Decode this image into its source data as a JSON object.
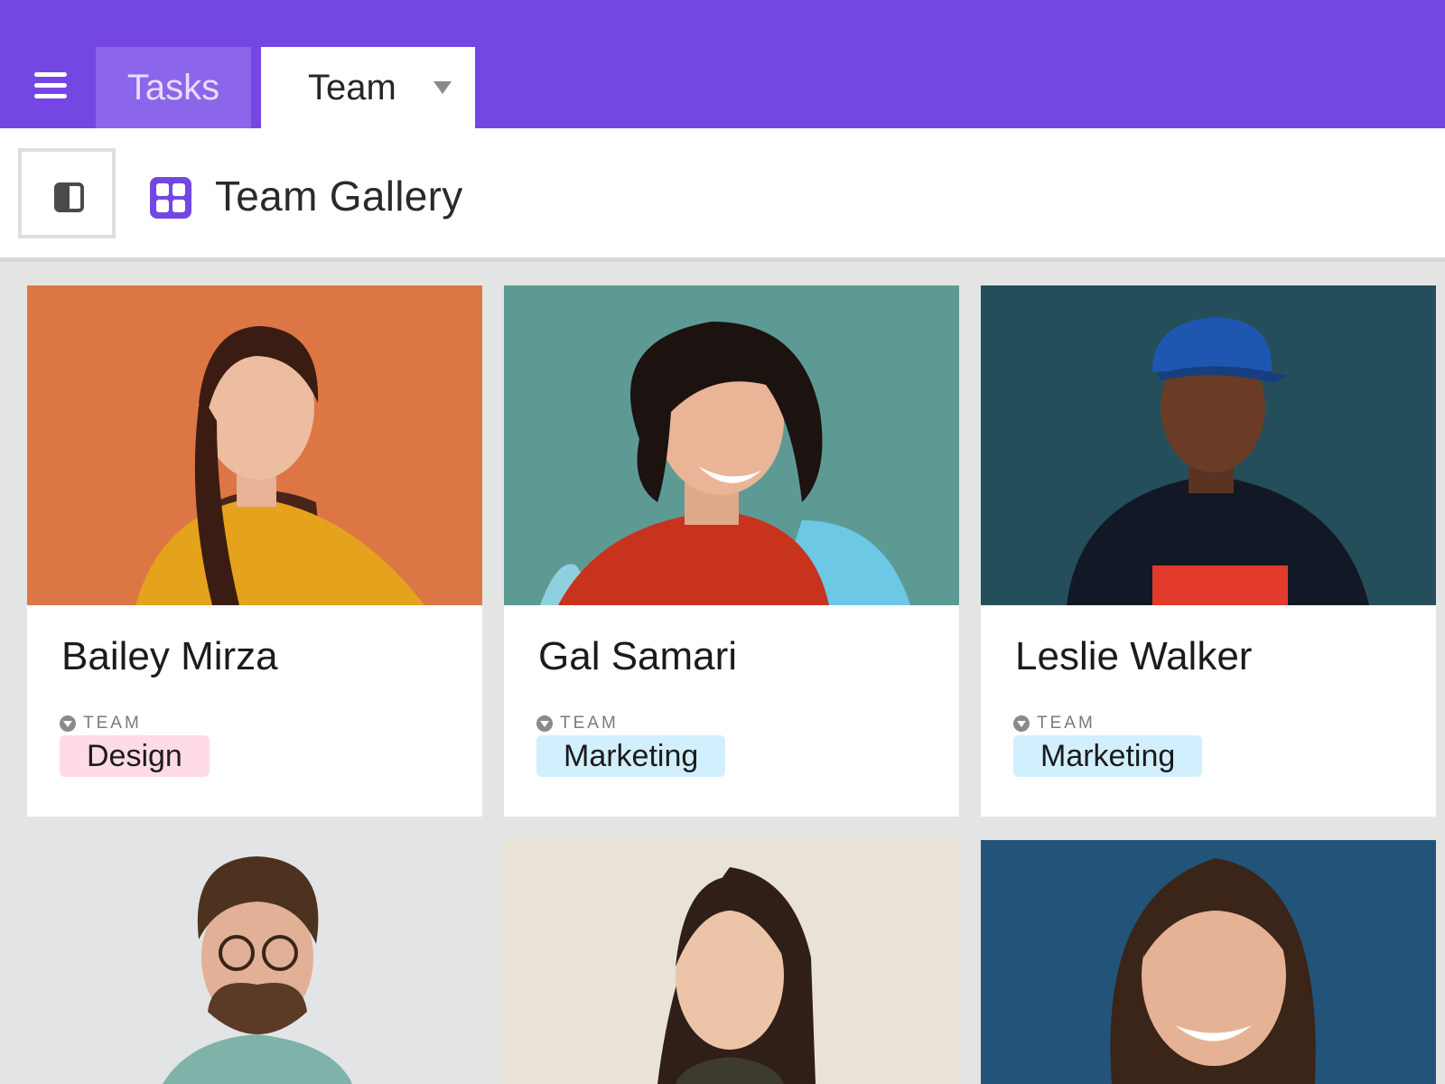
{
  "tabs": [
    {
      "label": "Tasks",
      "active": false
    },
    {
      "label": "Team",
      "active": true
    }
  ],
  "header": {
    "title": "Team Gallery"
  },
  "field_label": "TEAM",
  "cards": [
    {
      "name": "Bailey Mirza",
      "team": "Design"
    },
    {
      "name": "Gal Samari",
      "team": "Marketing"
    },
    {
      "name": "Leslie Walker",
      "team": "Marketing"
    },
    {
      "name": "",
      "team": ""
    },
    {
      "name": "",
      "team": ""
    },
    {
      "name": "",
      "team": ""
    }
  ],
  "colors": {
    "brand": "#7447e3",
    "tab_inactive": "#8c66ea",
    "tag_design": "#ffdbe6",
    "tag_marketing": "#d2efff"
  },
  "icons": {
    "menu": "hamburger-menu-icon",
    "sidebar": "sidebar-toggle-icon",
    "view": "gallery-grid-icon",
    "dropdown": "chevron-down-icon",
    "field": "single-select-field-icon"
  }
}
